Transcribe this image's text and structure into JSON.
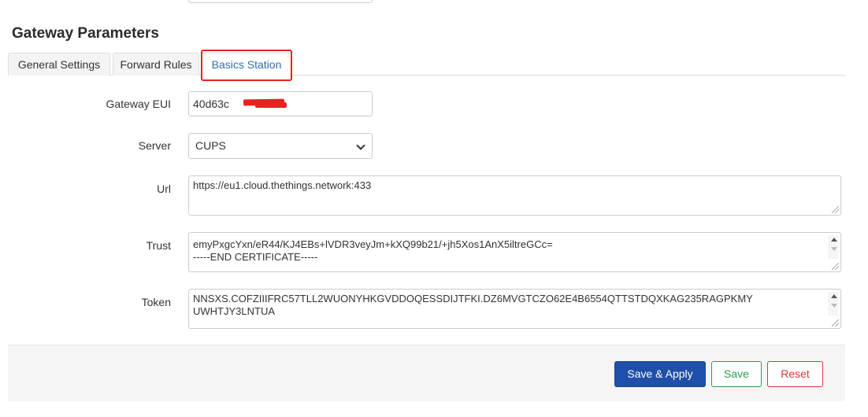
{
  "section": {
    "title": "Gateway Parameters"
  },
  "tabs": [
    {
      "label": "General Settings"
    },
    {
      "label": "Forward Rules"
    },
    {
      "label": "Basics Station"
    }
  ],
  "fields": {
    "gateway_eui": {
      "label": "Gateway EUI",
      "value": "40d63c"
    },
    "server": {
      "label": "Server",
      "value": "CUPS"
    },
    "url": {
      "label": "Url",
      "value": "https://eu1.cloud.thethings.network:433"
    },
    "trust": {
      "label": "Trust",
      "line1": "emyPxgcYxn/eR44/KJ4EBs+lVDR3veyJm+kXQ99b21/+jh5Xos1AnX5iltreGCc=",
      "line2": "-----END CERTIFICATE-----"
    },
    "token": {
      "label": "Token",
      "line1": "NNSXS.COFZIIIFRC57TLL2WUONYHKGVDDOQESSDIJTFKI.DZ6MVGTCZO62E4B6554QTTSTDQXKAG235RAGPKMY",
      "line2": "UWHTJY3LNTUA"
    }
  },
  "buttons": {
    "save_apply": "Save & Apply",
    "save": "Save",
    "reset": "Reset"
  },
  "colors": {
    "active_tab": "#2f6fb3",
    "highlight": "#e8231f",
    "primary": "#1f4fa8",
    "save": "#2e9d4f",
    "reset": "#d43a3a"
  }
}
